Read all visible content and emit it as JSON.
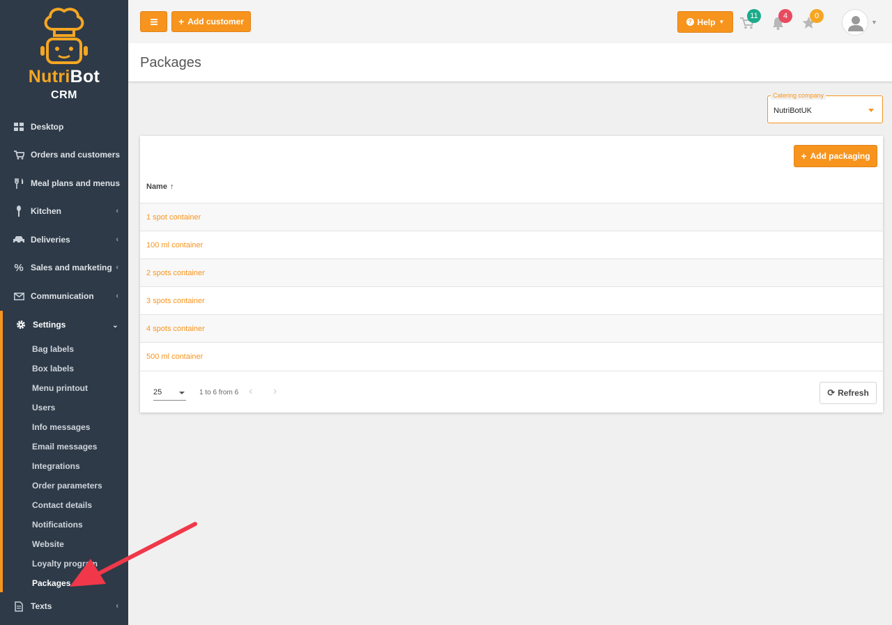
{
  "brand": {
    "name_part1": "Nutri",
    "name_part2": "Bot",
    "sub": "CRM"
  },
  "colors": {
    "accent": "#f7941d",
    "sidebar": "#2e3a48",
    "badge_cart": "#1aab8a",
    "badge_bell": "#e84a5f",
    "badge_star": "#f5a623"
  },
  "sidebar": {
    "items": [
      {
        "label": "Desktop",
        "icon": "grid-icon"
      },
      {
        "label": "Orders and customers",
        "icon": "cart-icon"
      },
      {
        "label": "Meal plans and menus",
        "icon": "cutlery-icon"
      },
      {
        "label": "Kitchen",
        "icon": "spoon-icon"
      },
      {
        "label": "Deliveries",
        "icon": "car-icon"
      },
      {
        "label": "Sales and marketing",
        "icon": "percent-icon"
      },
      {
        "label": "Communication",
        "icon": "envelope-icon"
      },
      {
        "label": "Settings",
        "icon": "gear-icon"
      },
      {
        "label": "Texts",
        "icon": "document-icon"
      }
    ],
    "settings_sub": [
      "Bag labels",
      "Box labels",
      "Menu printout",
      "Users",
      "Info messages",
      "Email messages",
      "Integrations",
      "Order parameters",
      "Contact details",
      "Notifications",
      "Website",
      "Loyalty program",
      "Packages"
    ]
  },
  "topbar": {
    "add_customer": "Add customer",
    "help": "Help",
    "cart_count": "11",
    "bell_count": "4",
    "star_count": "0"
  },
  "page": {
    "title": "Packages"
  },
  "catering": {
    "label": "Catering company",
    "value": "NutriBotUK"
  },
  "table": {
    "add_button": "Add packaging",
    "column_name": "Name",
    "rows": [
      "1 spot container",
      "100 ml container",
      "2 spots container",
      "3 spots container",
      "4 spots container",
      "500 ml container"
    ]
  },
  "footer": {
    "page_size": "25",
    "range": "1 to 6 from 6",
    "refresh": "Refresh"
  }
}
